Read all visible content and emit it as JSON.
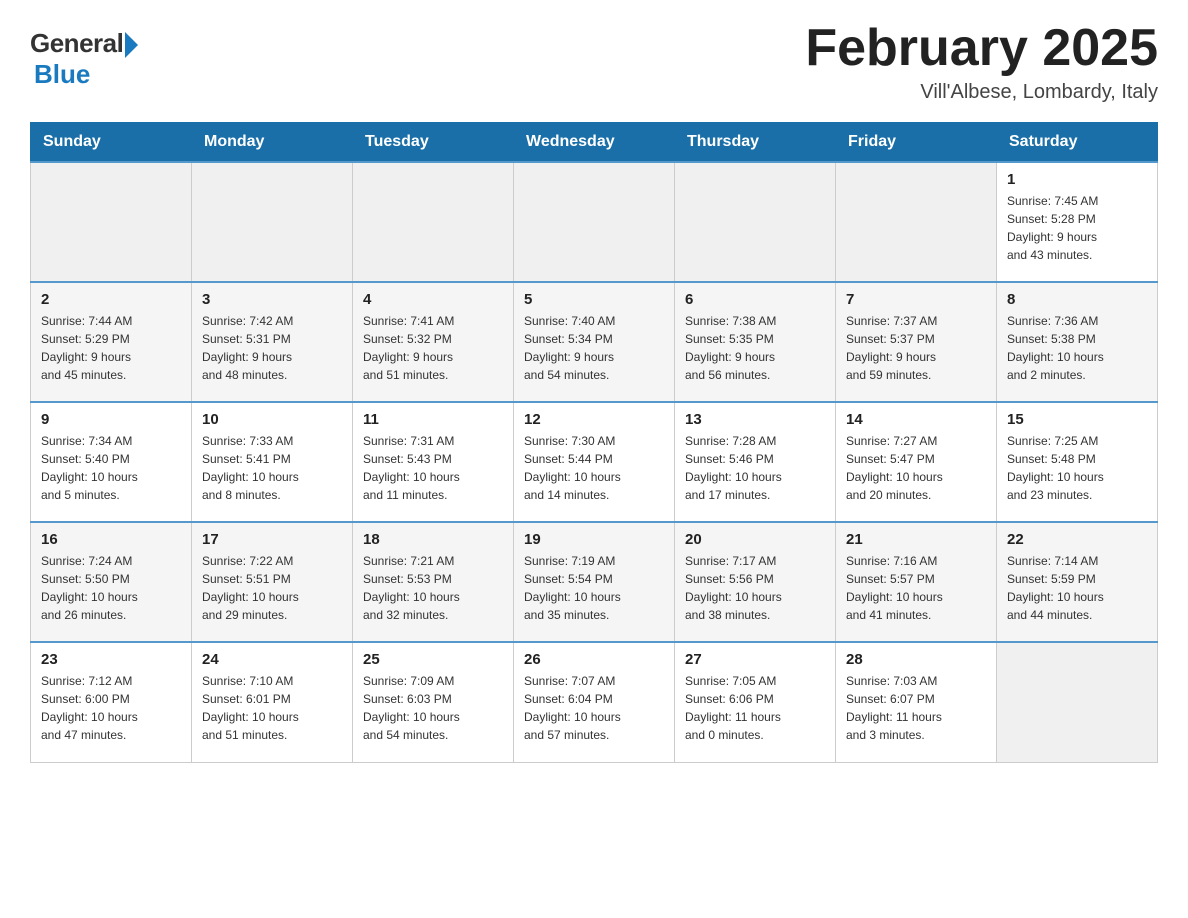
{
  "header": {
    "logo_general": "General",
    "logo_blue": "Blue",
    "title": "February 2025",
    "location": "Vill'Albese, Lombardy, Italy"
  },
  "days_of_week": [
    "Sunday",
    "Monday",
    "Tuesday",
    "Wednesday",
    "Thursday",
    "Friday",
    "Saturday"
  ],
  "weeks": [
    [
      {
        "day": "",
        "info": ""
      },
      {
        "day": "",
        "info": ""
      },
      {
        "day": "",
        "info": ""
      },
      {
        "day": "",
        "info": ""
      },
      {
        "day": "",
        "info": ""
      },
      {
        "day": "",
        "info": ""
      },
      {
        "day": "1",
        "info": "Sunrise: 7:45 AM\nSunset: 5:28 PM\nDaylight: 9 hours\nand 43 minutes."
      }
    ],
    [
      {
        "day": "2",
        "info": "Sunrise: 7:44 AM\nSunset: 5:29 PM\nDaylight: 9 hours\nand 45 minutes."
      },
      {
        "day": "3",
        "info": "Sunrise: 7:42 AM\nSunset: 5:31 PM\nDaylight: 9 hours\nand 48 minutes."
      },
      {
        "day": "4",
        "info": "Sunrise: 7:41 AM\nSunset: 5:32 PM\nDaylight: 9 hours\nand 51 minutes."
      },
      {
        "day": "5",
        "info": "Sunrise: 7:40 AM\nSunset: 5:34 PM\nDaylight: 9 hours\nand 54 minutes."
      },
      {
        "day": "6",
        "info": "Sunrise: 7:38 AM\nSunset: 5:35 PM\nDaylight: 9 hours\nand 56 minutes."
      },
      {
        "day": "7",
        "info": "Sunrise: 7:37 AM\nSunset: 5:37 PM\nDaylight: 9 hours\nand 59 minutes."
      },
      {
        "day": "8",
        "info": "Sunrise: 7:36 AM\nSunset: 5:38 PM\nDaylight: 10 hours\nand 2 minutes."
      }
    ],
    [
      {
        "day": "9",
        "info": "Sunrise: 7:34 AM\nSunset: 5:40 PM\nDaylight: 10 hours\nand 5 minutes."
      },
      {
        "day": "10",
        "info": "Sunrise: 7:33 AM\nSunset: 5:41 PM\nDaylight: 10 hours\nand 8 minutes."
      },
      {
        "day": "11",
        "info": "Sunrise: 7:31 AM\nSunset: 5:43 PM\nDaylight: 10 hours\nand 11 minutes."
      },
      {
        "day": "12",
        "info": "Sunrise: 7:30 AM\nSunset: 5:44 PM\nDaylight: 10 hours\nand 14 minutes."
      },
      {
        "day": "13",
        "info": "Sunrise: 7:28 AM\nSunset: 5:46 PM\nDaylight: 10 hours\nand 17 minutes."
      },
      {
        "day": "14",
        "info": "Sunrise: 7:27 AM\nSunset: 5:47 PM\nDaylight: 10 hours\nand 20 minutes."
      },
      {
        "day": "15",
        "info": "Sunrise: 7:25 AM\nSunset: 5:48 PM\nDaylight: 10 hours\nand 23 minutes."
      }
    ],
    [
      {
        "day": "16",
        "info": "Sunrise: 7:24 AM\nSunset: 5:50 PM\nDaylight: 10 hours\nand 26 minutes."
      },
      {
        "day": "17",
        "info": "Sunrise: 7:22 AM\nSunset: 5:51 PM\nDaylight: 10 hours\nand 29 minutes."
      },
      {
        "day": "18",
        "info": "Sunrise: 7:21 AM\nSunset: 5:53 PM\nDaylight: 10 hours\nand 32 minutes."
      },
      {
        "day": "19",
        "info": "Sunrise: 7:19 AM\nSunset: 5:54 PM\nDaylight: 10 hours\nand 35 minutes."
      },
      {
        "day": "20",
        "info": "Sunrise: 7:17 AM\nSunset: 5:56 PM\nDaylight: 10 hours\nand 38 minutes."
      },
      {
        "day": "21",
        "info": "Sunrise: 7:16 AM\nSunset: 5:57 PM\nDaylight: 10 hours\nand 41 minutes."
      },
      {
        "day": "22",
        "info": "Sunrise: 7:14 AM\nSunset: 5:59 PM\nDaylight: 10 hours\nand 44 minutes."
      }
    ],
    [
      {
        "day": "23",
        "info": "Sunrise: 7:12 AM\nSunset: 6:00 PM\nDaylight: 10 hours\nand 47 minutes."
      },
      {
        "day": "24",
        "info": "Sunrise: 7:10 AM\nSunset: 6:01 PM\nDaylight: 10 hours\nand 51 minutes."
      },
      {
        "day": "25",
        "info": "Sunrise: 7:09 AM\nSunset: 6:03 PM\nDaylight: 10 hours\nand 54 minutes."
      },
      {
        "day": "26",
        "info": "Sunrise: 7:07 AM\nSunset: 6:04 PM\nDaylight: 10 hours\nand 57 minutes."
      },
      {
        "day": "27",
        "info": "Sunrise: 7:05 AM\nSunset: 6:06 PM\nDaylight: 11 hours\nand 0 minutes."
      },
      {
        "day": "28",
        "info": "Sunrise: 7:03 AM\nSunset: 6:07 PM\nDaylight: 11 hours\nand 3 minutes."
      },
      {
        "day": "",
        "info": ""
      }
    ]
  ]
}
